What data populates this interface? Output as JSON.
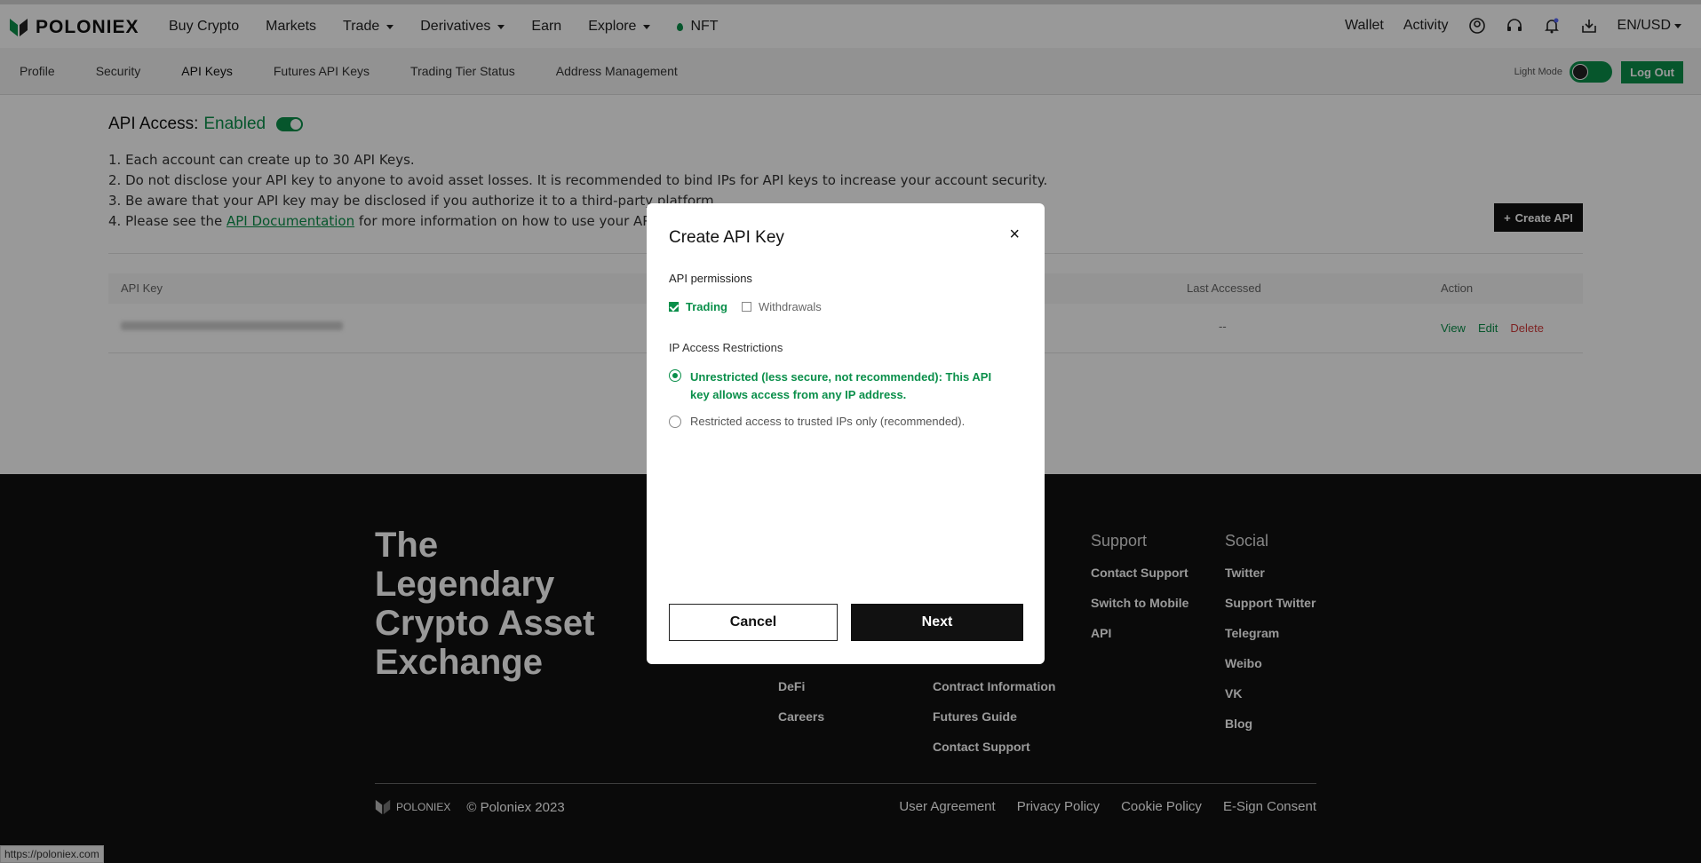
{
  "header": {
    "brand": "POLONIEX",
    "nav": [
      {
        "label": "Buy Crypto",
        "caret": false
      },
      {
        "label": "Markets",
        "caret": false
      },
      {
        "label": "Trade",
        "caret": true
      },
      {
        "label": "Derivatives",
        "caret": true
      },
      {
        "label": "Earn",
        "caret": false
      },
      {
        "label": "Explore",
        "caret": true
      },
      {
        "label": "NFT",
        "caret": false
      }
    ],
    "wallet": "Wallet",
    "activity": "Activity",
    "locale": "EN/USD"
  },
  "subnav": {
    "tabs": [
      "Profile",
      "Security",
      "API Keys",
      "Futures API Keys",
      "Trading Tier Status",
      "Address Management"
    ],
    "active_tab": "API Keys",
    "light_mode": "Light Mode",
    "logout": "Log Out"
  },
  "api": {
    "title_prefix": "API Access:",
    "status": "Enabled",
    "rules": [
      "1. Each account can create up to 30 API Keys.",
      "2. Do not disclose your API key to anyone to avoid asset losses. It is recommended to bind IPs for API keys to increase your account security.",
      "3. Be aware that your API key may be disclosed if you authorize it to a third-party platform."
    ],
    "rule4_prefix": "4. Please see the ",
    "rule4_link": "API Documentation",
    "rule4_suffix": " for more information on how to use your API keys.",
    "create_button": "Create API",
    "table": {
      "headers": [
        "API Key",
        "Last Accessed",
        "Action"
      ],
      "row": {
        "last_accessed": "--",
        "actions": [
          "View",
          "Edit",
          "Delete"
        ]
      }
    }
  },
  "footer": {
    "tagline": [
      "The",
      "Legendary",
      "Crypto Asset",
      "Exchange"
    ],
    "col1": [
      "DeFi",
      "Careers"
    ],
    "col2": [
      "Contract Information",
      "Futures Guide",
      "Contact Support"
    ],
    "support": {
      "heading": "Support",
      "items": [
        "Contact Support",
        "Switch to Mobile",
        "API"
      ]
    },
    "social": {
      "heading": "Social",
      "items": [
        "Twitter",
        "Support Twitter",
        "Telegram",
        "Weibo",
        "VK",
        "Blog"
      ]
    },
    "brand": "POLONIEX",
    "copyright": "© Poloniex 2023",
    "links": [
      "User Agreement",
      "Privacy Policy",
      "Cookie Policy",
      "E-Sign Consent"
    ]
  },
  "modal": {
    "title": "Create API Key",
    "close": "×",
    "permissions_label": "API permissions",
    "trading": "Trading",
    "withdrawals": "Withdrawals",
    "ip_label": "IP Access Restrictions",
    "option_unrestricted": "Unrestricted (less secure, not recommended): This API key allows access from any IP address.",
    "option_restricted": "Restricted access to trusted IPs only (recommended).",
    "cancel": "Cancel",
    "next": "Next"
  },
  "status_bar": "https://poloniex.com",
  "colors": {
    "accent": "#0a8f4a",
    "dark": "#111111",
    "danger": "#d23b3b"
  }
}
